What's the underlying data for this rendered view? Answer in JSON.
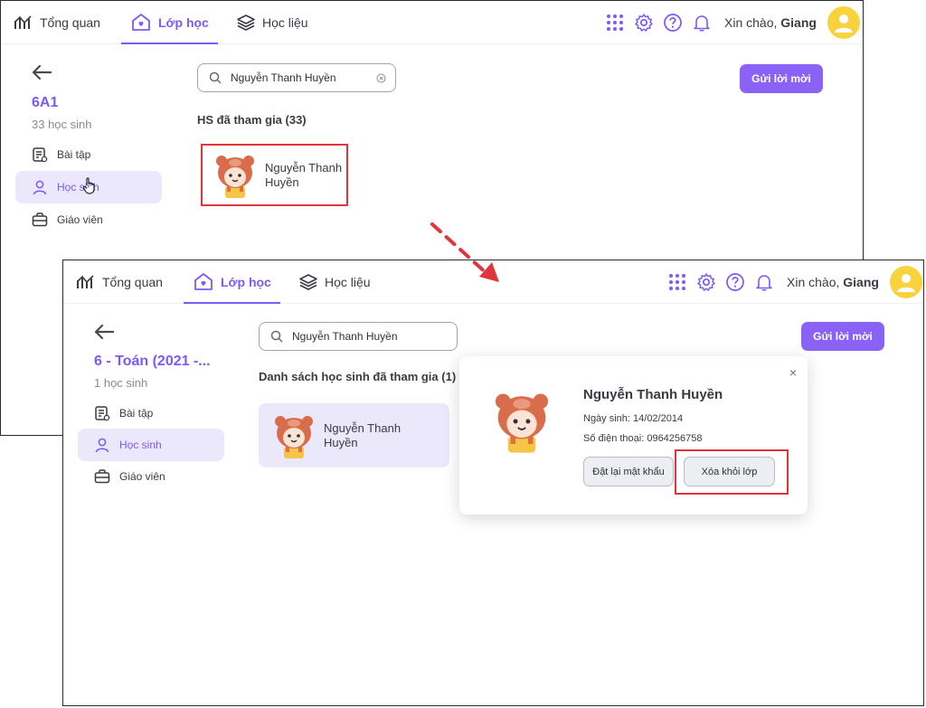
{
  "nav": {
    "tabs": [
      "Tổng quan",
      "Lớp học",
      "Học liệu"
    ],
    "greeting": "Xin chào,",
    "user_name": "Giang"
  },
  "screen1": {
    "class_name": "6A1",
    "student_count": "33 học sinh",
    "sidebar": [
      "Bài tập",
      "Học sinh",
      "Giáo viên"
    ],
    "search_value": "Nguyễn Thanh Huyền",
    "invite_label": "Gửi lời mời",
    "section_title": "HS đã tham gia (33)",
    "student_name": "Nguyễn Thanh Huyền"
  },
  "screen2": {
    "class_name": "6 - Toán (2021 -...",
    "student_count": "1 học sinh",
    "sidebar": [
      "Bài tập",
      "Học sinh",
      "Giáo viên"
    ],
    "search_value": "Nguyễn Thanh Huyền",
    "invite_label": "Gửi lời mời",
    "section_title": "Danh sách học sinh đã tham gia (1)",
    "student_name": "Nguyễn Thanh Huyền",
    "popup": {
      "name": "Nguyễn Thanh Huyền",
      "birthday": "Ngày sinh: 14/02/2014",
      "phone": "Số điện thoại: 0964256758",
      "reset_password_label": "Đặt lại mật khẩu",
      "remove_label": "Xóa khỏi lớp",
      "close_symbol": "×"
    }
  },
  "colors": {
    "accent": "#7a5af8",
    "button": "#8a63f6",
    "highlight": "#e0353c",
    "avatar": "#f9d33e"
  }
}
